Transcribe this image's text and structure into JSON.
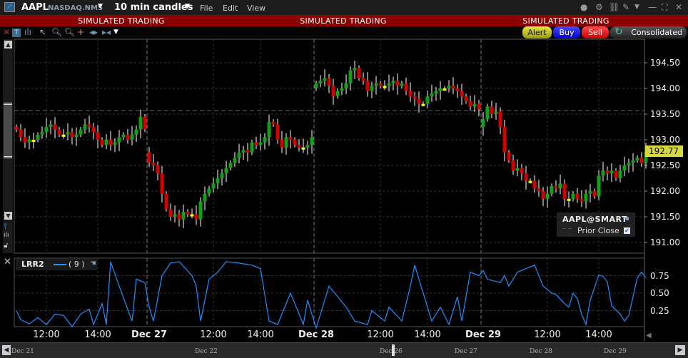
{
  "header": {
    "symbol": "AAPL",
    "exchange": "NASDAQ.NMS",
    "interval": "10 min candles",
    "menus": [
      "File",
      "Edit",
      "View"
    ]
  },
  "banner": {
    "text": "SIMULATED TRADING"
  },
  "toolbar": {
    "alert": "Alert",
    "buy": "Buy",
    "sell": "Sell",
    "feed": "Consolidated"
  },
  "colors": {
    "up": "#14a014",
    "down": "#d40000",
    "doji": "#ffff00",
    "indicator": "#1e90ff",
    "banner": "#8a0000",
    "price_tag": "#d8d840"
  },
  "legend": {
    "title": "AAPL@SMART",
    "prior_close": "Prior Close"
  },
  "indicator": {
    "name": "LRR2",
    "param": "( 9 )",
    "yticks": [
      "0.75",
      "0.50",
      "0.25"
    ]
  },
  "last_price": "192.77",
  "nav_labels": [
    "Dec 21",
    "Dec 22",
    "Dec 26",
    "Dec 27",
    "Dec 28",
    "Dec 29"
  ],
  "chart_data": {
    "type": "candlestick",
    "prior_close": 193.57,
    "ylim": [
      190.85,
      194.95
    ],
    "yticks": [
      "194.50",
      "194.00",
      "193.50",
      "193.00",
      "192.50",
      "192.00",
      "191.50",
      "191.00"
    ],
    "xticks": [
      {
        "label": "12:00",
        "bar": 7,
        "bold": false
      },
      {
        "label": "14:00",
        "bar": 19,
        "bold": false
      },
      {
        "label": "Dec 27",
        "bar": 31,
        "bold": true
      },
      {
        "label": "12:00",
        "bar": 46,
        "bold": false
      },
      {
        "label": "14:00",
        "bar": 57,
        "bold": false
      },
      {
        "label": "Dec 28",
        "bar": 70,
        "bold": true
      },
      {
        "label": "12:00",
        "bar": 85,
        "bold": false
      },
      {
        "label": "14:00",
        "bar": 96,
        "bold": false
      },
      {
        "label": "Dec 29",
        "bar": 109,
        "bold": true
      },
      {
        "label": "12:00",
        "bar": 124,
        "bold": false
      },
      {
        "label": "14:00",
        "bar": 136,
        "bold": false
      }
    ],
    "day_breaks": [
      31,
      70,
      109
    ],
    "closes": [
      193.2,
      193.05,
      192.95,
      193.0,
      193.0,
      193.1,
      193.15,
      193.25,
      193.3,
      193.2,
      193.1,
      193.1,
      193.15,
      193.05,
      193.1,
      193.2,
      193.3,
      193.25,
      193.15,
      193.0,
      192.9,
      193.0,
      192.9,
      192.95,
      193.05,
      193.1,
      193.0,
      193.1,
      193.2,
      193.45,
      193.2,
      192.55,
      192.5,
      192.35,
      191.95,
      191.65,
      191.5,
      191.55,
      191.45,
      191.6,
      191.55,
      191.55,
      191.45,
      191.8,
      191.95,
      192.05,
      192.15,
      192.25,
      192.35,
      192.45,
      192.55,
      192.65,
      192.75,
      192.8,
      192.75,
      192.95,
      192.9,
      192.95,
      193.05,
      193.35,
      193.3,
      193.0,
      192.85,
      193.05,
      193.0,
      192.9,
      192.85,
      192.85,
      192.9,
      193.05,
      194.1,
      194.15,
      194.2,
      194.05,
      193.85,
      193.95,
      194.0,
      194.1,
      194.35,
      194.4,
      194.2,
      194.15,
      193.95,
      194.05,
      194.1,
      194.05,
      194.05,
      194.1,
      194.15,
      194.05,
      194.1,
      193.95,
      193.85,
      193.8,
      193.7,
      193.7,
      193.85,
      193.9,
      193.95,
      194.0,
      194.0,
      194.05,
      194.0,
      193.95,
      193.85,
      193.75,
      193.65,
      193.7,
      193.6,
      193.4,
      193.65,
      193.5,
      193.55,
      193.25,
      192.75,
      192.6,
      192.4,
      192.45,
      192.35,
      192.2,
      192.2,
      192.05,
      192.0,
      191.85,
      191.95,
      192.1,
      192.05,
      192.15,
      191.85,
      191.85,
      191.95,
      191.85,
      191.8,
      191.95,
      192.0,
      191.9,
      192.3,
      192.4,
      192.35,
      192.4,
      192.25,
      192.4,
      192.5,
      192.55,
      192.6,
      192.65,
      192.55,
      192.77
    ],
    "indicator_series": [
      [
        0,
        0.25
      ],
      [
        1,
        0.12
      ],
      [
        3,
        0.06
      ],
      [
        5,
        0.15
      ],
      [
        7,
        0.05
      ],
      [
        9,
        0.2
      ],
      [
        11,
        0.18
      ],
      [
        13,
        0.02
      ],
      [
        15,
        0.2
      ],
      [
        17,
        0.27
      ],
      [
        18,
        0.05
      ],
      [
        20,
        0.35
      ],
      [
        21,
        0.05
      ],
      [
        22,
        0.95
      ],
      [
        24,
        0.6
      ],
      [
        27,
        0.1
      ],
      [
        28,
        0.7
      ],
      [
        30,
        0.65
      ],
      [
        31,
        0.3
      ],
      [
        32,
        0.1
      ],
      [
        34,
        0.75
      ],
      [
        36,
        0.93
      ],
      [
        38,
        0.95
      ],
      [
        41,
        0.75
      ],
      [
        42,
        0.6
      ],
      [
        43,
        0.1
      ],
      [
        45,
        0.7
      ],
      [
        47,
        0.8
      ],
      [
        49,
        0.95
      ],
      [
        52,
        0.93
      ],
      [
        55,
        0.9
      ],
      [
        57,
        0.85
      ],
      [
        59,
        0.1
      ],
      [
        61,
        0.05
      ],
      [
        64,
        0.5
      ],
      [
        66,
        0.2
      ],
      [
        67,
        0.05
      ],
      [
        68,
        0.4
      ],
      [
        70,
        0.0
      ],
      [
        73,
        0.6
      ],
      [
        75,
        0.45
      ],
      [
        77,
        0.3
      ],
      [
        79,
        0.1
      ],
      [
        82,
        0.05
      ],
      [
        83,
        0.25
      ],
      [
        86,
        0.1
      ],
      [
        87,
        0.3
      ],
      [
        90,
        0.1
      ],
      [
        92,
        0.6
      ],
      [
        93,
        0.9
      ],
      [
        95,
        0.5
      ],
      [
        97,
        0.1
      ],
      [
        99,
        0.3
      ],
      [
        101,
        0.05
      ],
      [
        103,
        0.45
      ],
      [
        104,
        0.1
      ],
      [
        106,
        0.8
      ],
      [
        108,
        0.75
      ],
      [
        109,
        0.82
      ],
      [
        110,
        0.7
      ],
      [
        113,
        0.65
      ],
      [
        114,
        0.75
      ],
      [
        115,
        0.6
      ],
      [
        117,
        0.8
      ],
      [
        119,
        0.85
      ],
      [
        121,
        0.9
      ],
      [
        123,
        0.6
      ],
      [
        125,
        0.5
      ],
      [
        126,
        0.48
      ],
      [
        128,
        0.35
      ],
      [
        129,
        0.3
      ],
      [
        130,
        0.5
      ],
      [
        131,
        0.42
      ],
      [
        132,
        0.2
      ],
      [
        133,
        0.05
      ],
      [
        134,
        0.4
      ],
      [
        136,
        0.76
      ],
      [
        137,
        0.74
      ],
      [
        138,
        0.66
      ],
      [
        139,
        0.32
      ],
      [
        141,
        0.2
      ],
      [
        142,
        0.1
      ],
      [
        143,
        0.18
      ],
      [
        144,
        0.45
      ],
      [
        145,
        0.72
      ],
      [
        146,
        0.8
      ],
      [
        147,
        0.72
      ]
    ]
  }
}
